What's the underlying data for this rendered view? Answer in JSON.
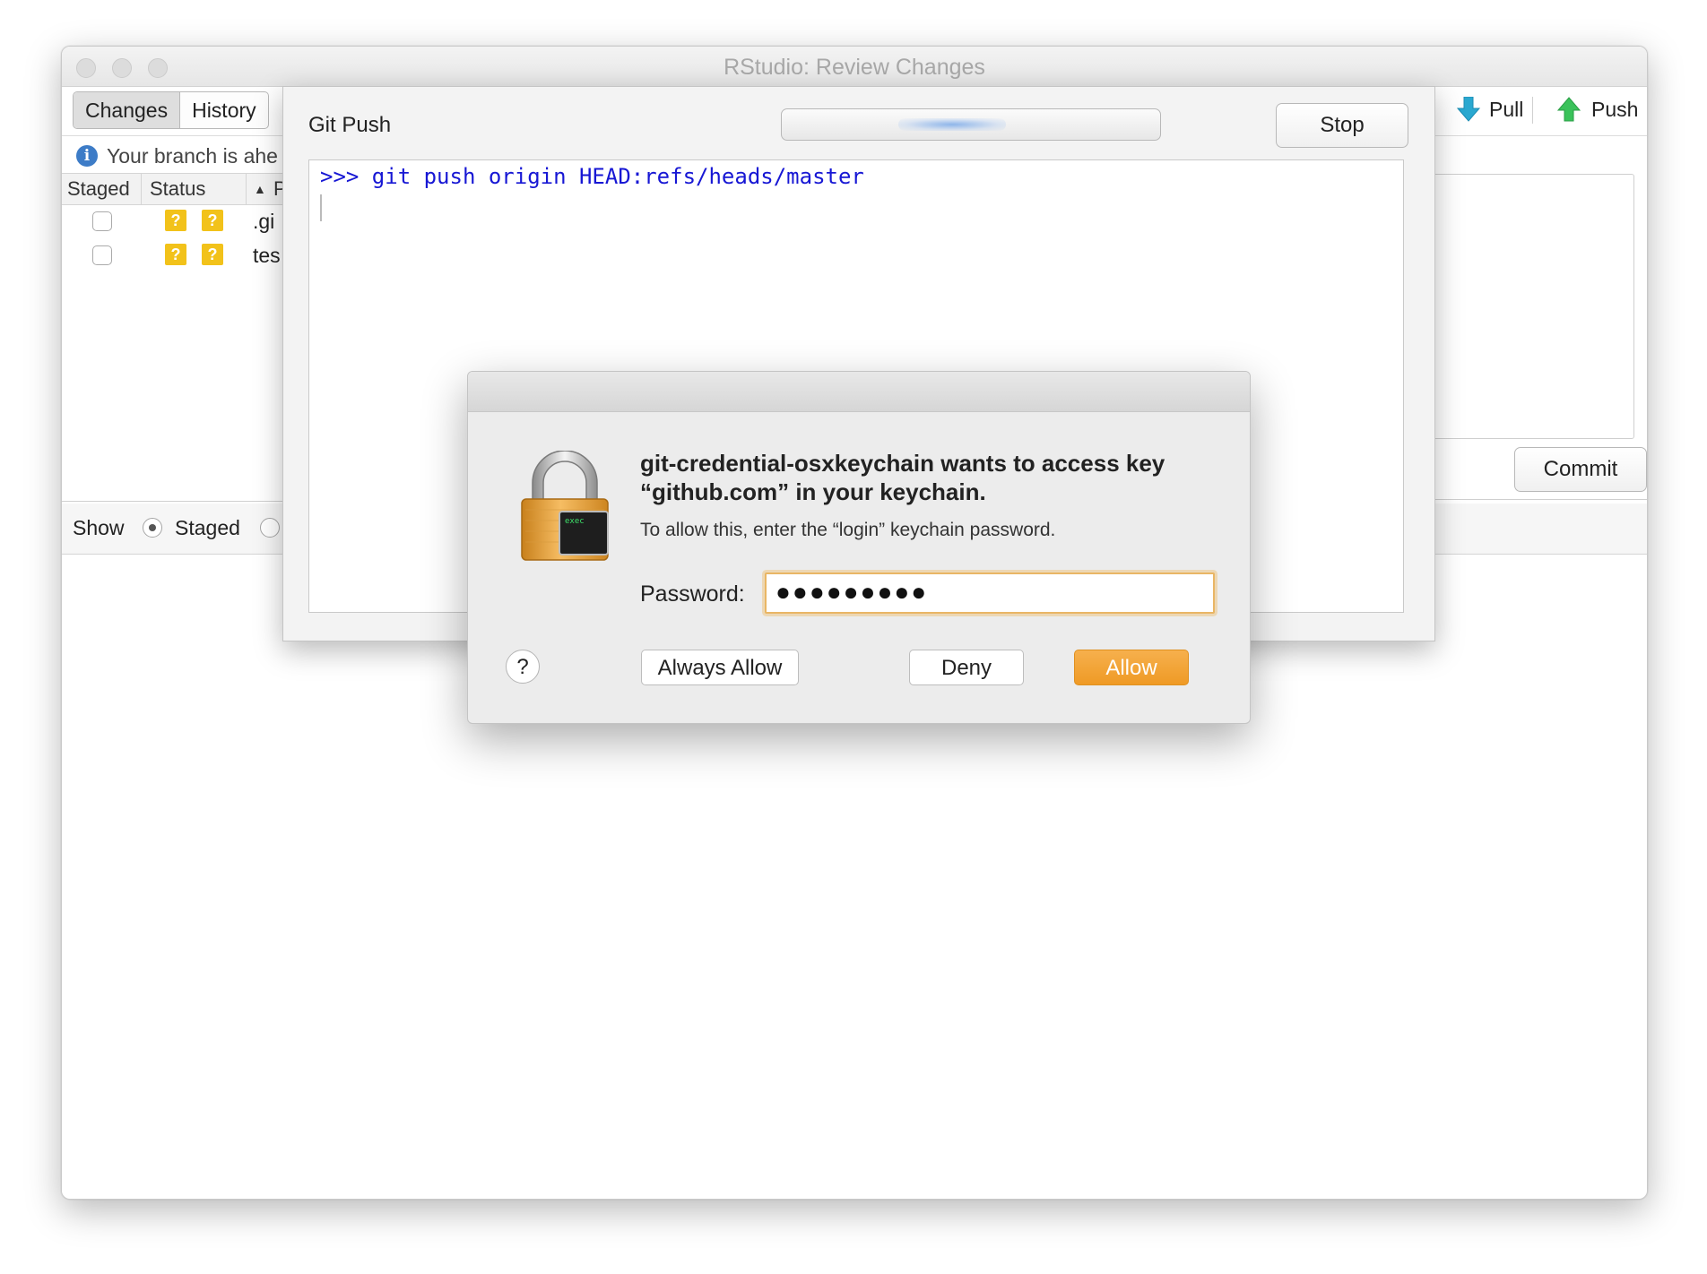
{
  "window": {
    "title": "RStudio: Review Changes",
    "tabs": [
      {
        "label": "Changes",
        "active": true
      },
      {
        "label": "History",
        "active": false
      }
    ],
    "toolbar": {
      "pull_label": "Pull",
      "push_label": "Push"
    },
    "branch_status": "Your branch is ahe",
    "grid": {
      "headers": [
        "Staged",
        "Status",
        "P"
      ],
      "rows": [
        {
          "staged": false,
          "status": [
            "?",
            "?"
          ],
          "name": ".gi"
        },
        {
          "staged": false,
          "status": [
            "?",
            "?"
          ],
          "name": "tes"
        }
      ]
    },
    "show_row": {
      "label": "Show",
      "options": [
        {
          "label": "Staged",
          "selected": true
        },
        {
          "label": "",
          "selected": false
        }
      ]
    },
    "commit_label": "Commit"
  },
  "git_push": {
    "title": "Git Push",
    "stop_label": "Stop",
    "command": ">>> git push origin HEAD:refs/heads/master"
  },
  "keychain_dialog": {
    "heading": "git-credential-osxkeychain wants to access key “github.com” in your keychain.",
    "subtext": "To allow this, enter the “login” keychain password.",
    "password_label": "Password:",
    "password_value": "●●●●●●●●●",
    "help_label": "?",
    "always_allow_label": "Always Allow",
    "deny_label": "Deny",
    "allow_label": "Allow",
    "lock_badge": "exec",
    "colors": {
      "primary": "#f0a030",
      "focus_ring": "#e9b665"
    }
  }
}
